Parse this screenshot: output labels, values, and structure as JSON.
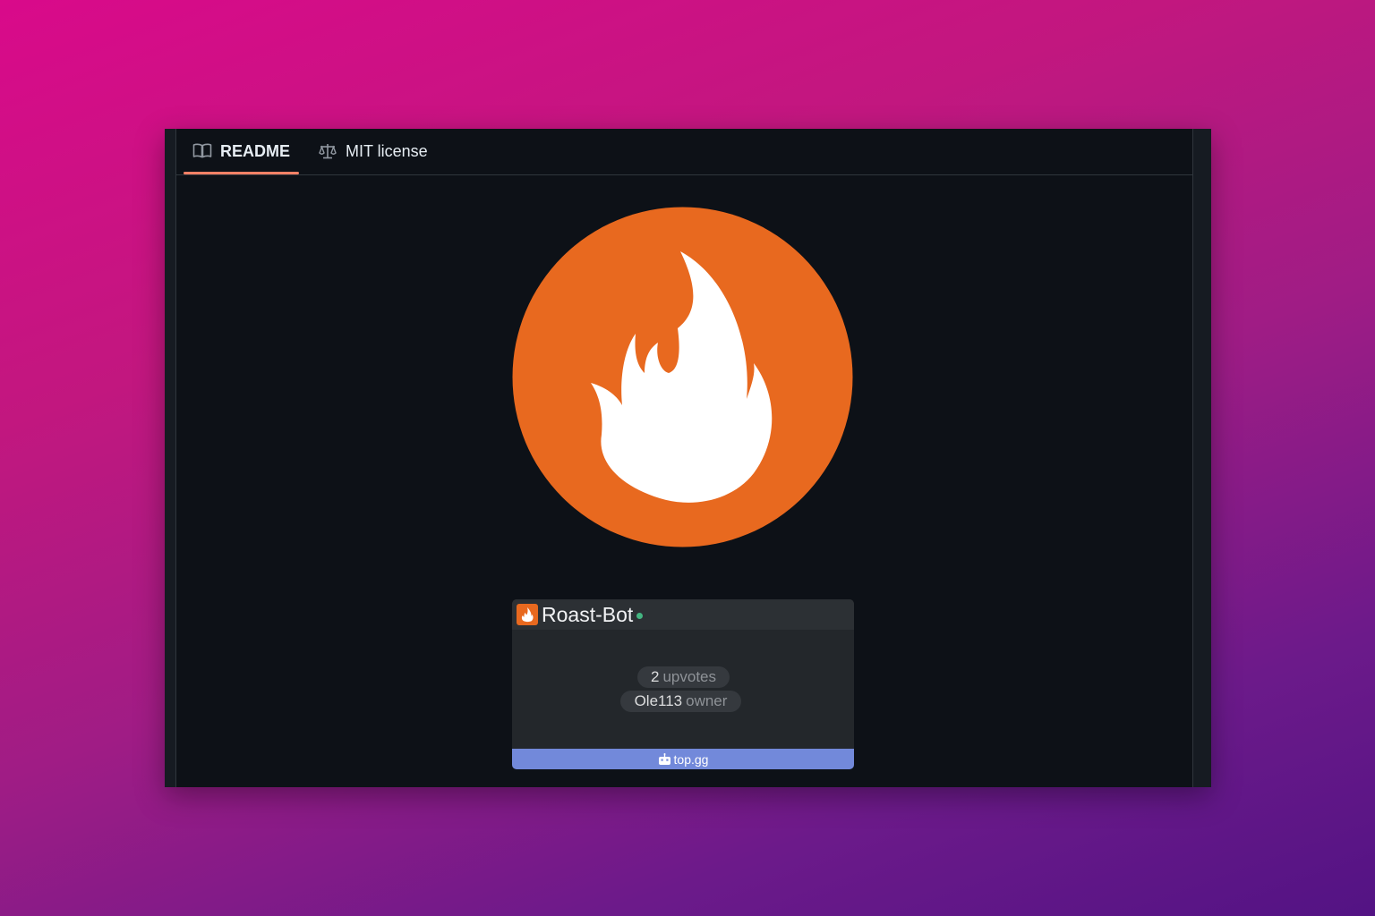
{
  "tabs": {
    "readme": {
      "label": "README",
      "icon": "book-icon",
      "active": true
    },
    "license": {
      "label": "MIT license",
      "icon": "scale-icon",
      "active": false
    }
  },
  "logo": {
    "icon": "flame-icon",
    "color": "#e8691f"
  },
  "widget": {
    "bot_name": "Roast-Bot",
    "status_color": "#43b581",
    "upvotes_count": "2",
    "upvotes_label": "upvotes",
    "owner_name": "Ole113",
    "owner_label": "owner",
    "footer_label": "top.gg",
    "footer_color": "#7289da"
  },
  "colors": {
    "accent_tab_underline": "#f78166",
    "background": "#0d1117"
  }
}
